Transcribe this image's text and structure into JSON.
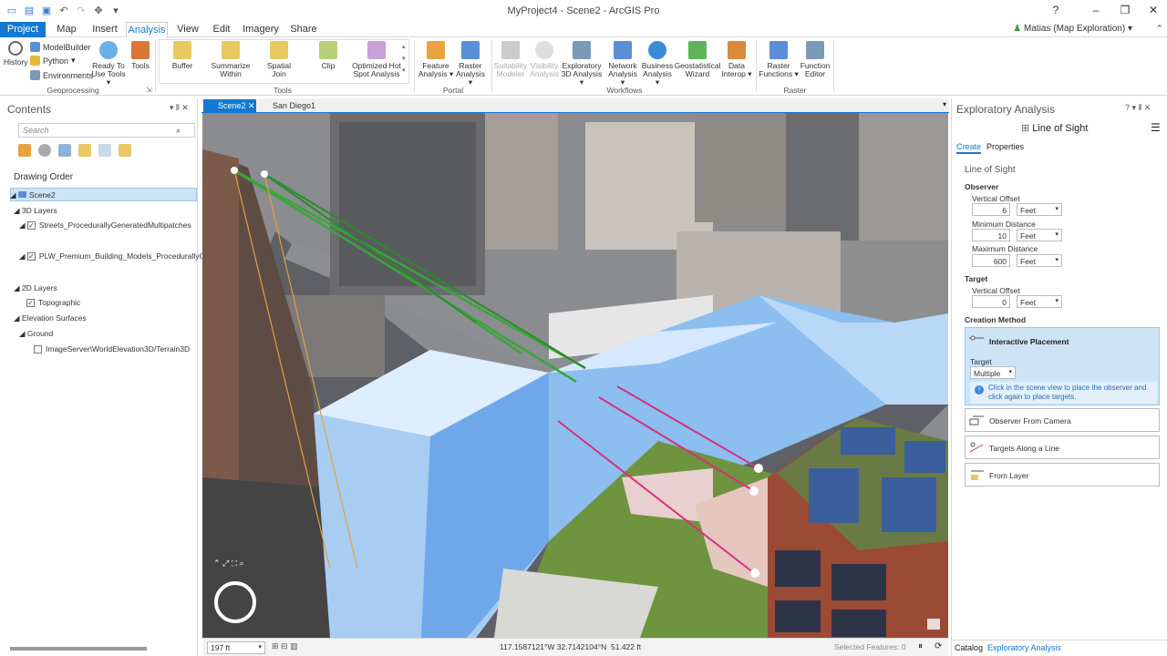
{
  "app": {
    "title": "MyProject4 - Scene2 - ArcGIS Pro",
    "help": "?",
    "user": "Matias (Map Exploration)"
  },
  "ribbon_tabs": [
    "Project",
    "Map",
    "Insert",
    "Analysis",
    "View",
    "Edit",
    "Imagery",
    "Share"
  ],
  "ribbon": {
    "geoprocessing": {
      "history": "History",
      "modelbuilder": "ModelBuilder",
      "python": "Python",
      "environments": "Environments",
      "ready_to_use": "Ready To Use Tools",
      "tools": "Tools",
      "group": "Geoprocessing"
    },
    "tools": {
      "buffer": "Buffer",
      "summarize": "Summarize Within",
      "spatial_join": "Spatial Join",
      "clip": "Clip",
      "hotspot": "Optimized Hot Spot Analysis",
      "group": "Tools"
    },
    "portal": {
      "feature": "Feature Analysis",
      "raster": "Raster Analysis",
      "group": "Portal"
    },
    "workflows": {
      "suitability": "Suitability Modeler",
      "visibility": "Visibility Analysis",
      "exploratory": "Exploratory 3D Analysis",
      "network": "Network Analysis",
      "business": "Business Analysis",
      "geostat": "Geostatistical Wizard",
      "interop": "Data Interop",
      "group": "Workflows"
    },
    "raster": {
      "functions": "Raster Functions",
      "editor": "Function Editor",
      "group": "Raster"
    }
  },
  "contents": {
    "title": "Contents",
    "search_placeholder": "Search",
    "drawing_order": "Drawing Order",
    "scene": "Scene2",
    "layers_3d": "3D Layers",
    "layer1": "Streets_ProcedurallyGeneratedMultipatches",
    "layer2": "PLW_Premium_Building_Models_ProcedurallyGen",
    "layers_2d": "2D Layers",
    "layer3": "Topographic",
    "elevation": "Elevation Surfaces",
    "ground": "Ground",
    "elev_source": "ImageServer\\WorldElevation3D/Terrain3D"
  },
  "view_tabs": [
    {
      "label": "Scene2"
    },
    {
      "label": "San Diego1"
    }
  ],
  "status": {
    "scale": "197 ft",
    "coords": "117.1587121°W 32.7142104°N",
    "elev": "51.422 ft",
    "selected": "Selected Features: 0"
  },
  "explore": {
    "title": "Exploratory Analysis",
    "tool": "Line of Sight",
    "tab_create": "Create",
    "tab_properties": "Properties",
    "section": "Line of Sight",
    "observer": "Observer",
    "vert_offset_label": "Vertical Offset",
    "vert_offset": "6",
    "min_dist_label": "Minimum Distance",
    "min_dist": "10",
    "max_dist_label": "Maximum Distance",
    "max_dist": "600",
    "unit": "Feet",
    "target": "Target",
    "target_offset_label": "Vertical Offset",
    "target_offset": "0",
    "creation_method": "Creation Method",
    "interactive": "Interactive Placement",
    "target_label": "Target",
    "target_mode": "Multiple",
    "info": "Click in the scene view to place the observer and click again to place targets.",
    "from_camera": "Observer From Camera",
    "along_line": "Targets Along a Line",
    "from_layer": "From Layer"
  },
  "bottom_tabs": {
    "catalog": "Catalog",
    "exploratory": "Exploratory Analysis"
  }
}
